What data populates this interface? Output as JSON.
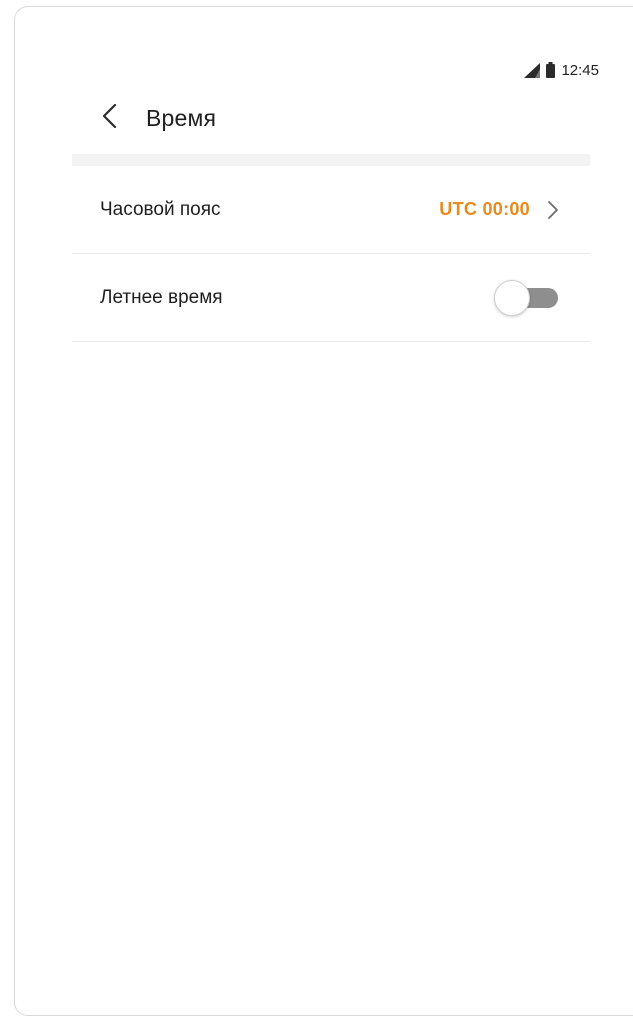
{
  "status_bar": {
    "time": "12:45",
    "signal_icon": "signal-icon",
    "battery_icon": "battery-icon"
  },
  "header": {
    "back_icon": "chevron-left-icon",
    "title": "Время"
  },
  "settings": {
    "timezone": {
      "label": "Часовой пояс",
      "value": "UTC 00:00",
      "value_color": "#e88a1c",
      "icon": "chevron-right-icon"
    },
    "dst": {
      "label": "Летнее время",
      "enabled": false
    }
  },
  "colors": {
    "accent": "#e88a1c",
    "toggle_off": "#8e8e8e"
  }
}
